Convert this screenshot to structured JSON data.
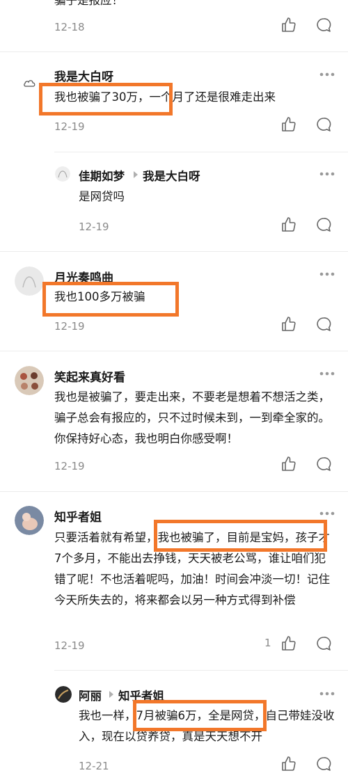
{
  "comments": [
    {
      "body": "骗子是报应！",
      "date": "12-18"
    },
    {
      "name": "我是大白呀",
      "body": "我也被骗了30万，一个月了还是很难走出来",
      "date": "12-19"
    },
    {
      "name": "佳期如梦",
      "reply_to": "我是大白呀",
      "body": "是网贷吗",
      "date": "12-19"
    },
    {
      "name": "月光奏鸣曲",
      "body": "我也100多万被骗",
      "date": "12-19"
    },
    {
      "name": "笑起来真好看",
      "body": "我也是被骗了，要走出来，不要老是想着不想活之类，骗子总会有报应的，只不过时候未到，一到牵全家的。你保持好心态，我也明白你感受啊！",
      "date": "12-19"
    },
    {
      "name": "知乎者姐",
      "body": "只要活着就有希望，我也被骗了，目前是宝妈，孩子才7个多月，不能出去挣钱，天天被老公骂，谁让咱们犯错了呢！不也活着呢吗，加油！时间会冲淡一切！记住今天所失去的，将来都会以另一种方式得到补偿",
      "date": "12-19",
      "likes": "1"
    },
    {
      "name": "阿丽",
      "reply_to": "知乎者姐",
      "body": "我也一样，7月被骗6万，全是网贷，自己带娃没收入，现在以贷养贷，真是天天想不开",
      "date": "12-21"
    }
  ],
  "colors": {
    "highlight": "#f2772a",
    "meta": "#8a8a8a"
  },
  "icons": [
    "thumbs-up-icon",
    "comment-bubble-icon",
    "more-dots-icon",
    "reply-arrow-icon"
  ]
}
